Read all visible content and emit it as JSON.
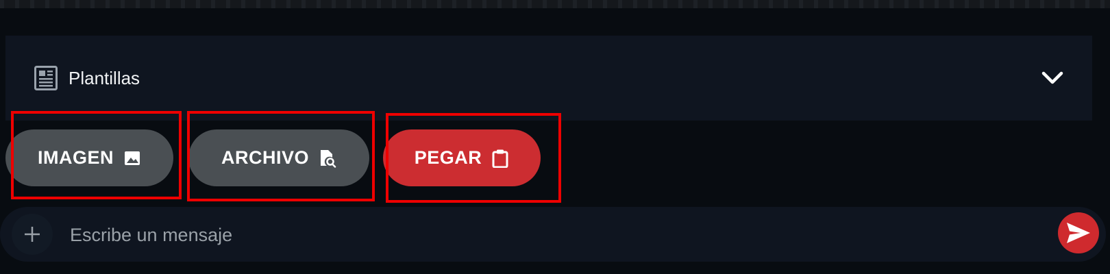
{
  "templates": {
    "label": "Plantillas",
    "icon": "templates-icon",
    "expand_icon": "chevron-down-icon"
  },
  "actions": [
    {
      "label": "IMAGEN",
      "icon": "image-icon",
      "color": "#4a4f53"
    },
    {
      "label": "ARCHIVO",
      "icon": "file-search-icon",
      "color": "#4a4f53"
    },
    {
      "label": "PEGAR",
      "icon": "clipboard-icon",
      "color": "#cc2d31"
    }
  ],
  "composer": {
    "placeholder": "Escribe un mensaje",
    "add_icon": "plus-icon",
    "send_icon": "send-icon"
  },
  "colors": {
    "background": "#080c11",
    "panel": "#0f1520",
    "accent": "#cf2a2e",
    "highlight": "#ee0000"
  }
}
